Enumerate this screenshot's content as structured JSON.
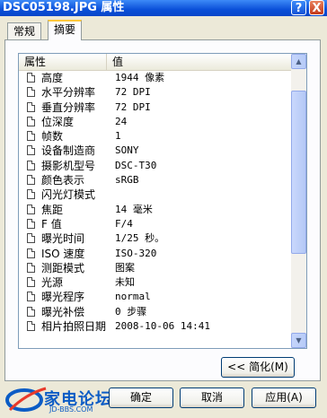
{
  "window": {
    "title": "DSC05198.JPG 属性",
    "help_label": "?",
    "close_label": "X"
  },
  "tabs": [
    {
      "label": "常规",
      "active": false
    },
    {
      "label": "摘要",
      "active": true
    }
  ],
  "list": {
    "headers": {
      "name": "属性",
      "value": "值"
    },
    "rows": [
      {
        "name": "高度",
        "value": "1944 像素"
      },
      {
        "name": "水平分辨率",
        "value": "72 DPI"
      },
      {
        "name": "垂直分辨率",
        "value": "72 DPI"
      },
      {
        "name": "位深度",
        "value": "24"
      },
      {
        "name": "帧数",
        "value": "1"
      },
      {
        "name": "设备制造商",
        "value": "SONY"
      },
      {
        "name": "摄影机型号",
        "value": "DSC-T30"
      },
      {
        "name": "颜色表示",
        "value": "sRGB"
      },
      {
        "name": "闪光灯模式",
        "value": ""
      },
      {
        "name": "焦距",
        "value": "14 毫米"
      },
      {
        "name": "F 值",
        "value": "F/4"
      },
      {
        "name": "曝光时间",
        "value": "1/25 秒。"
      },
      {
        "name": "ISO 速度",
        "value": "ISO-320"
      },
      {
        "name": "测距模式",
        "value": "图案"
      },
      {
        "name": "光源",
        "value": "未知"
      },
      {
        "name": "曝光程序",
        "value": "normal"
      },
      {
        "name": "曝光补偿",
        "value": "0 步骤"
      },
      {
        "name": "相片拍照日期",
        "value": "2008-10-06 14:41"
      }
    ]
  },
  "buttons": {
    "simplify": "<< 简化(M)",
    "ok": "确定",
    "cancel": "取消",
    "apply": "应用(A)"
  },
  "logo": {
    "text": "家电论坛",
    "sub": "JD-BBS.COM"
  },
  "colors": {
    "titlebar": "#0a4fd8",
    "tab_highlight": "#ffc83c",
    "logo": "#0b5cc5"
  }
}
